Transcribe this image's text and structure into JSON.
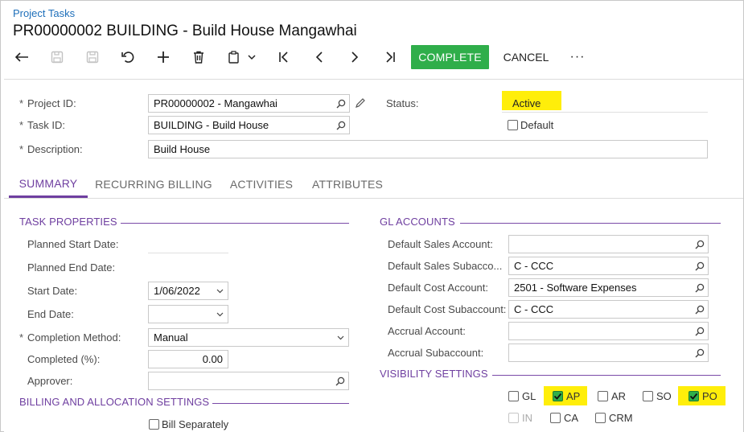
{
  "breadcrumb": "Project Tasks",
  "title": "PR00000002 BUILDING - Build House Mangawhai",
  "toolbar": {
    "icons": [
      "undo-back-icon",
      "save-close-icon",
      "save-icon",
      "revert-icon",
      "add-icon",
      "delete-icon",
      "copy-paste-icon",
      "first-record-icon",
      "previous-record-icon",
      "next-record-icon",
      "last-record-icon"
    ],
    "complete_label": "COMPLETE",
    "cancel_label": "CANCEL",
    "more_label": "···",
    "complete_color": "#2fae4a"
  },
  "header": {
    "project_id_label": "Project ID:",
    "project_id_value": "PR00000002 - Mangawhai",
    "task_id_label": "Task ID:",
    "task_id_value": "BUILDING - Build House",
    "description_label": "Description:",
    "description_value": "Build House",
    "status_label": "Status:",
    "status_value": "Active",
    "default_label": "Default",
    "default_checked": false
  },
  "tabs": [
    {
      "label": "SUMMARY",
      "active": true
    },
    {
      "label": "RECURRING BILLING",
      "active": false
    },
    {
      "label": "ACTIVITIES",
      "active": false
    },
    {
      "label": "ATTRIBUTES",
      "active": false
    }
  ],
  "task_properties": {
    "title": "TASK PROPERTIES",
    "planned_start_label": "Planned Start Date:",
    "planned_end_label": "Planned End Date:",
    "start_date_label": "Start Date:",
    "start_date_value": "1/06/2022",
    "end_date_label": "End Date:",
    "end_date_value": "",
    "completion_method_label": "Completion Method:",
    "completion_method_value": "Manual",
    "completed_label": "Completed (%):",
    "completed_value": "0.00",
    "approver_label": "Approver:",
    "approver_value": ""
  },
  "billing": {
    "title": "BILLING AND ALLOCATION SETTINGS",
    "bill_separately_label": "Bill Separately",
    "bill_separately_checked": false
  },
  "gl_accounts": {
    "title": "GL ACCOUNTS",
    "default_sales_account_label": "Default Sales Account:",
    "default_sales_account_value": "",
    "default_sales_sub_label": "Default Sales Subacco...",
    "default_sales_sub_value": "C - CCC",
    "default_cost_account_label": "Default Cost Account:",
    "default_cost_account_value": "2501 - Software Expenses",
    "default_cost_sub_label": "Default Cost Subaccount:",
    "default_cost_sub_value": "C - CCC",
    "accrual_account_label": "Accrual Account:",
    "accrual_account_value": "",
    "accrual_sub_label": "Accrual Subaccount:",
    "accrual_sub_value": ""
  },
  "visibility": {
    "title": "VISIBILITY SETTINGS",
    "items": [
      {
        "label": "GL",
        "checked": false,
        "disabled": false,
        "highlighted": false
      },
      {
        "label": "AP",
        "checked": true,
        "disabled": false,
        "highlighted": true
      },
      {
        "label": "AR",
        "checked": false,
        "disabled": false,
        "highlighted": false
      },
      {
        "label": "SO",
        "checked": false,
        "disabled": false,
        "highlighted": false
      },
      {
        "label": "PO",
        "checked": true,
        "disabled": false,
        "highlighted": true
      },
      {
        "label": "IN",
        "checked": false,
        "disabled": true,
        "highlighted": false
      },
      {
        "label": "CA",
        "checked": false,
        "disabled": false,
        "highlighted": false
      },
      {
        "label": "CRM",
        "checked": false,
        "disabled": false,
        "highlighted": false
      }
    ]
  },
  "colors": {
    "accent": "#6f3fa0",
    "link": "#1e6fba",
    "highlight": "#ffee0a"
  }
}
